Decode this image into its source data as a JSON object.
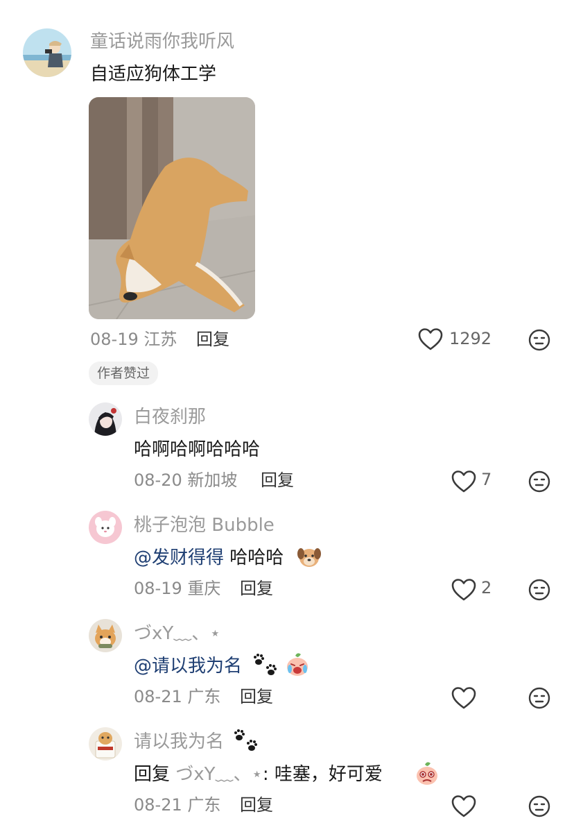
{
  "main_comment": {
    "username": "童话说雨你我听风",
    "text": "自适应狗体工学",
    "date": "08-19",
    "location": "江苏",
    "reply_label": "回复",
    "likes": "1292",
    "badge": "作者赞过"
  },
  "replies": [
    {
      "username": "白夜刹那",
      "text": "哈啊哈啊哈哈哈",
      "date": "08-20",
      "location": "新加坡",
      "reply_label": "回复",
      "likes": "7"
    },
    {
      "username": "桃子泡泡 Bubble",
      "mention": "@发财得得",
      "text": " 哈哈哈",
      "date": "08-19",
      "location": "重庆",
      "reply_label": "回复",
      "likes": "2"
    },
    {
      "username": "づxY﹏、⋆",
      "mention": "@请以我为名",
      "text": "",
      "date": "08-21",
      "location": "广东",
      "reply_label": "回复",
      "likes": ""
    },
    {
      "username": "请以我为名",
      "reply_prefix": "回复 ",
      "reply_to": "づxY﹏、⋆",
      "text": ": 哇塞，好可爱",
      "date": "08-21",
      "location": "广东",
      "reply_label": "回复",
      "likes": ""
    }
  ],
  "icons": {
    "like": "heart-outline-icon",
    "react": "neutral-face-icon",
    "paw": "paw-prints-emoji",
    "dog": "dog-face-emoji",
    "crying": "crying-peach-emoji",
    "pleading": "pleading-peach-emoji"
  }
}
